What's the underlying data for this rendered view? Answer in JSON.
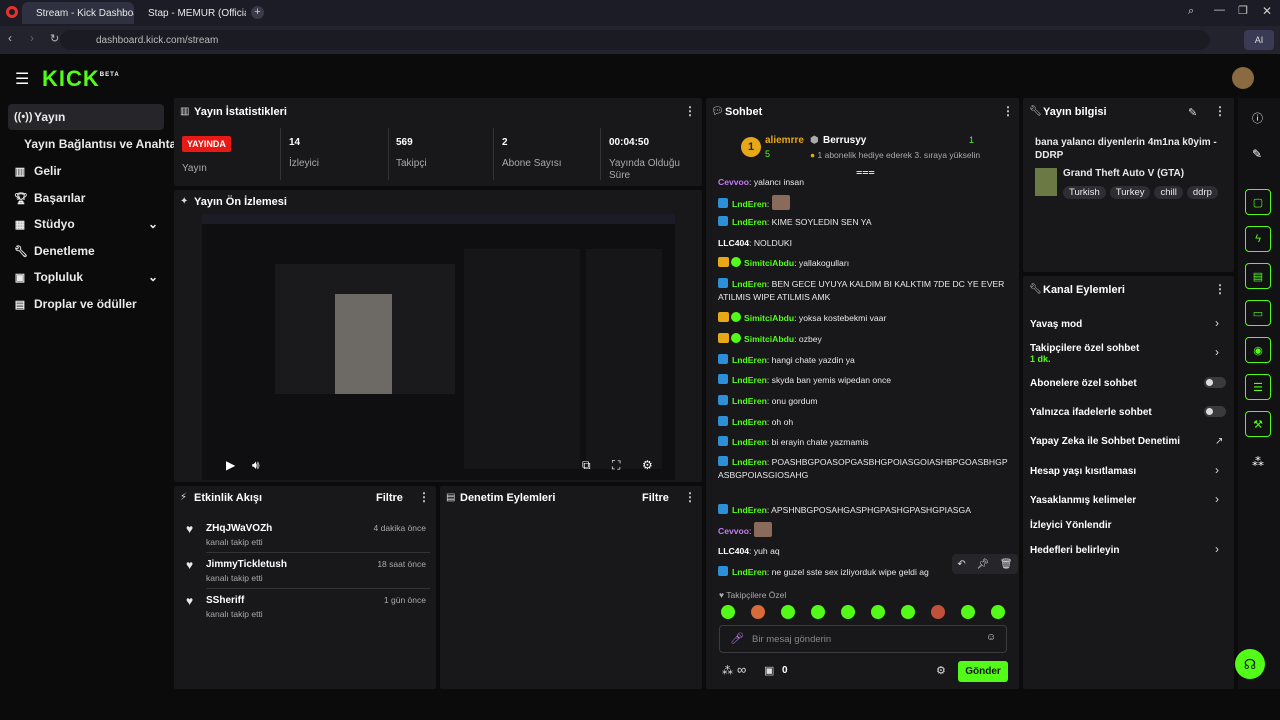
{
  "browser": {
    "tabs": [
      {
        "label": "Stream - Kick Dashboard"
      },
      {
        "label": "Stap - MEMUR (Officia"
      }
    ],
    "url": "dashboard.kick.com/stream",
    "ai_label": "AI"
  },
  "app": {
    "brand": "KICK",
    "beta": "BETA"
  },
  "sidebar": {
    "items": [
      {
        "label": "Yayın"
      },
      {
        "label": "Yayın Bağlantısı ve Anahtarı"
      },
      {
        "label": "Gelir"
      },
      {
        "label": "Başarılar"
      },
      {
        "label": "Stüdyo"
      },
      {
        "label": "Denetleme"
      },
      {
        "label": "Topluluk"
      },
      {
        "label": "Droplar ve ödüller"
      }
    ]
  },
  "stats": {
    "title": "Yayın İstatistikleri",
    "live_badge": "YAYINDA",
    "live_label": "Yayın",
    "viewers": "14",
    "viewers_label": "İzleyici",
    "followers": "569",
    "followers_label": "Takipçi",
    "subs": "2",
    "subs_label": "Abone Sayısı",
    "uptime": "00:04:50",
    "uptime_label": "Yayında Olduğu Süre"
  },
  "preview": {
    "title": "Yayın Ön İzlemesi"
  },
  "activity": {
    "title": "Etkinlik Akışı",
    "filter": "Filtre",
    "items": [
      {
        "name": "ZHqJWaVOZh",
        "sub": "kanalı takip etti",
        "time": "4 dakika önce"
      },
      {
        "name": "JimmyTickletush",
        "sub": "kanalı takip etti",
        "time": "18 saat önce"
      },
      {
        "name": "SSheriff",
        "sub": "kanalı takip etti",
        "time": "1 gün önce"
      }
    ]
  },
  "moderation": {
    "title": "Denetim Eylemleri",
    "filter": "Filtre"
  },
  "chat": {
    "title": "Sohbet",
    "top_user": "aliemrre",
    "top_user_count": "5",
    "gifter": "Berrusyy",
    "gift_count": "1",
    "gift_text": "1 abonelik hediye ederek 3. sıraya yükselin",
    "messages": [
      {
        "user": "Cevvoo",
        "text": "yalancı insan"
      },
      {
        "user": "LndEren",
        "text": ""
      },
      {
        "user": "LndEren",
        "text": "KIME SOYLEDIN SEN YA"
      },
      {
        "user": "LLC404",
        "text": "NOLDUKI"
      },
      {
        "user": "SimitciAbdu",
        "text": "yallakogulları"
      },
      {
        "user": "LndEren",
        "text": "BEN GECE UYUYA KALDIM BI KALKTIM 7DE DC YE EVER ATILMIS WIPE ATILMIS AMK"
      },
      {
        "user": "SimitciAbdu",
        "text": "yoksa kostebekmi vaar"
      },
      {
        "user": "SimitciAbdu",
        "text": "ozbey"
      },
      {
        "user": "LndEren",
        "text": "hangi chate yazdin ya"
      },
      {
        "user": "LndEren",
        "text": "skyda ban yemis wipedan once"
      },
      {
        "user": "LndEren",
        "text": "onu gordum"
      },
      {
        "user": "LndEren",
        "text": "oh oh"
      },
      {
        "user": "LndEren",
        "text": "bi erayin chate yazmamis"
      },
      {
        "user": "LndEren",
        "text": "POASHBGPOASOPGASBHGPOIASGOIASHBPGOASBHGPASBGPOIASGIOSAHG"
      },
      {
        "user": "LndEren",
        "text": "APSHNBGPOSAHGASPHGPASHGPASHGPIASGA"
      },
      {
        "user": "Cevvoo",
        "text": ""
      },
      {
        "user": "LLC404",
        "text": "yuh aq"
      },
      {
        "user": "LndEren",
        "text": "ne guzel sste sex izliyorduk wipe geldi ag"
      }
    ],
    "followers_only": "Takipçilere Özel",
    "input_placeholder": "Bir mesaj gönderin",
    "points": "∞",
    "gift_value": "0",
    "send": "Gönder",
    "colors": {
      "LndEren": "#53fc18",
      "SimitciAbdu": "#53fc18",
      "LLC404": "#ffffff",
      "Cevvoo": "#c07cf0"
    }
  },
  "info": {
    "title": "Yayın bilgisi",
    "stream_title": "bana yalancı diyenlerin 4m1na k0yim - DDRP",
    "category": "Grand Theft Auto V (GTA)",
    "tags": [
      "Turkish",
      "Turkey",
      "chill",
      "ddrp"
    ]
  },
  "channel_actions": {
    "title": "Kanal Eylemleri",
    "items": [
      {
        "label": "Yavaş mod"
      },
      {
        "label": "Takipçilere özel sohbet",
        "sub": "1 dk."
      },
      {
        "label": "Abonelere özel sohbet"
      },
      {
        "label": "Yalnızca ifadelerle sohbet"
      },
      {
        "label": "Yapay Zeka ile Sohbet Denetimi"
      },
      {
        "label": "Hesap yaşı kısıtlaması"
      },
      {
        "label": "Yasaklanmış kelimeler"
      },
      {
        "label": "İzleyici Yönlendir"
      },
      {
        "label": "Hedefleri belirleyin"
      }
    ]
  },
  "colors": {
    "accent": "#53fc18",
    "live": "#e91916",
    "panel": "#18181b"
  }
}
